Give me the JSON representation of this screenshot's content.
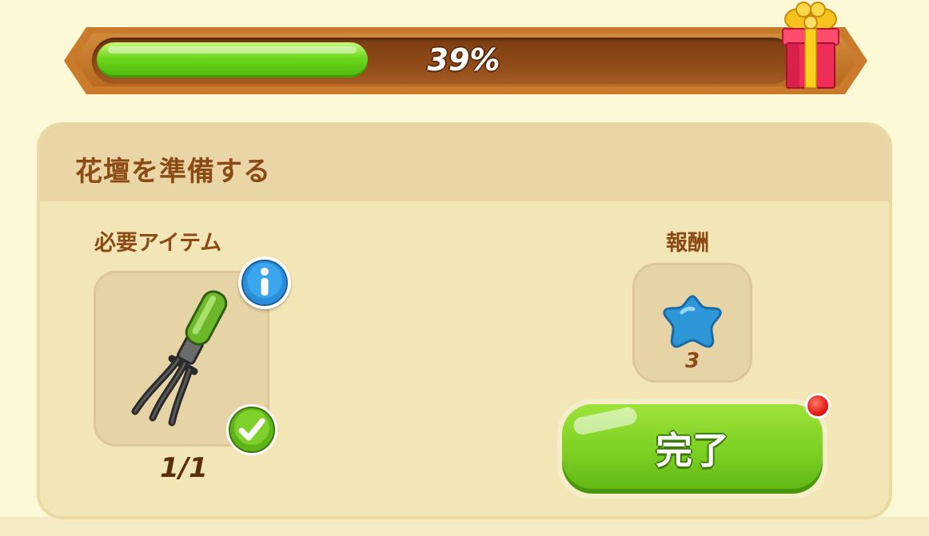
{
  "progress": {
    "value_percent": 39,
    "label": "39%",
    "fill_color": "#6ed61c"
  },
  "reward_chest": {
    "icon": "gift-box-icon"
  },
  "task": {
    "title": "花壇を準備する",
    "required_label": "必要アイテム",
    "required_item": {
      "icon": "garden-fork-icon",
      "count": "1/1",
      "info_icon": "info-icon",
      "status_icon": "check-icon"
    },
    "reward_label": "報酬",
    "reward": {
      "icon": "blue-star-icon",
      "amount": "3"
    },
    "complete_button_label": "完了",
    "notification_dot": "red-dot"
  },
  "colors": {
    "background": "#fdf8d6",
    "title_brown": "#8c4a14",
    "button_green": "#7ccf22",
    "progress_frame": "#c97a2a"
  }
}
